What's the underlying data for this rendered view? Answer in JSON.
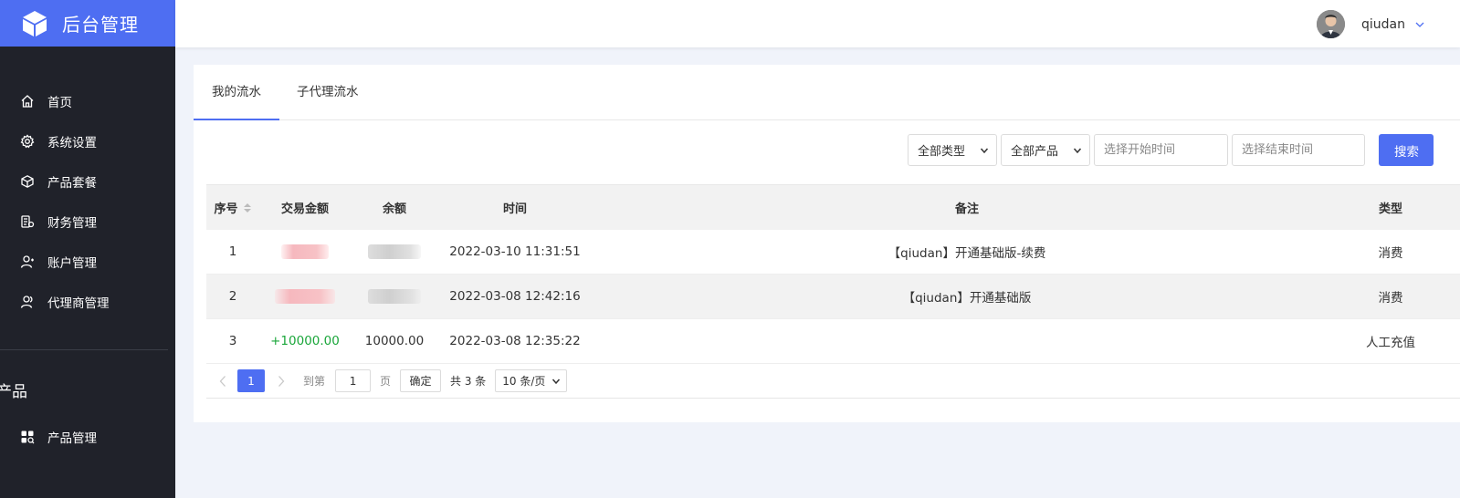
{
  "app": {
    "title": "后台管理"
  },
  "colors": {
    "primary": "#4e6ef2",
    "sidebar_bg": "#20222a",
    "positive": "#1aa63a"
  },
  "sidebar": {
    "items": [
      {
        "label": "首页",
        "icon": "home-icon"
      },
      {
        "label": "系统设置",
        "icon": "gear-icon"
      },
      {
        "label": "产品套餐",
        "icon": "cube-icon"
      },
      {
        "label": "财务管理",
        "icon": "finance-icon"
      },
      {
        "label": "账户管理",
        "icon": "user-icon"
      },
      {
        "label": "代理商管理",
        "icon": "agent-icon"
      }
    ],
    "section_title": "产品",
    "section_items": [
      {
        "label": "产品管理",
        "icon": "apps-icon"
      }
    ]
  },
  "header": {
    "username": "qiudan"
  },
  "tabs": [
    {
      "label": "我的流水",
      "active": true
    },
    {
      "label": "子代理流水",
      "active": false
    }
  ],
  "filters": {
    "type_select": "全部类型",
    "product_select": "全部产品",
    "start_placeholder": "选择开始时间",
    "end_placeholder": "选择结束时间",
    "search_label": "搜索"
  },
  "table": {
    "columns": [
      "序号",
      "交易金额",
      "余额",
      "时间",
      "备注",
      "类型"
    ],
    "rows": [
      {
        "no": "1",
        "amount": "",
        "balance": "",
        "time": "2022-03-10 11:31:51",
        "note": "【qiudan】开通基础版-续费",
        "type": "消费"
      },
      {
        "no": "2",
        "amount": "",
        "balance": "",
        "time": "2022-03-08 12:42:16",
        "note": "【qiudan】开通基础版",
        "type": "消费"
      },
      {
        "no": "3",
        "amount": "+10000.00",
        "balance": "10000.00",
        "time": "2022-03-08 12:35:22",
        "note": "",
        "type": "人工充值"
      }
    ]
  },
  "pagination": {
    "current_page": "1",
    "goto_label": "到第",
    "goto_value": "1",
    "page_label": "页",
    "confirm_label": "确定",
    "total_label": "共 3 条",
    "page_size": "10 条/页"
  }
}
